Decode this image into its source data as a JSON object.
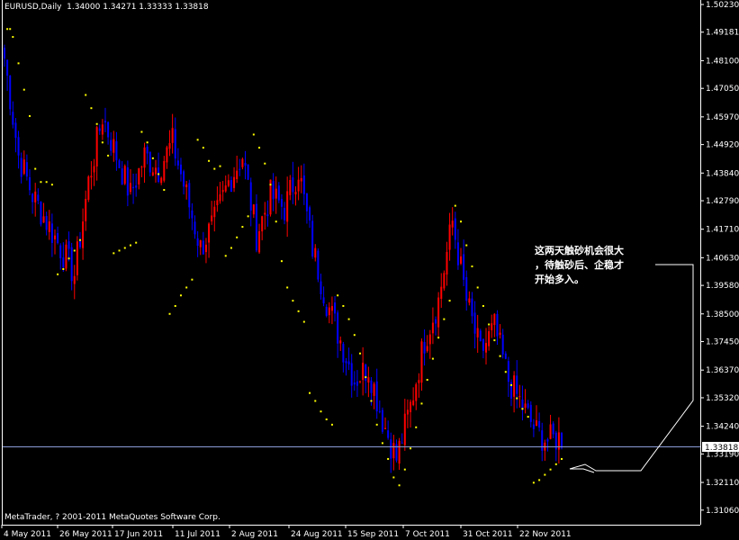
{
  "header": {
    "symbol": "EURUSD,Daily",
    "ohlc": "1.34000 1.34271 1.33333 1.33818"
  },
  "copyright": "MetaTrader, ? 2001-2011 MetaQuotes Software Corp.",
  "annotation": [
    "这两天触砂机会很大",
    "，待触砂后、企稳才",
    "开始多入。"
  ],
  "colors": {
    "background": "#000000",
    "bull_candle": "#ff0000",
    "bear_candle": "#0000ff",
    "parabolic_sar": "#ffff00",
    "axis": "#ffffff",
    "current_price_line": "#8c9bd6"
  },
  "chart_data": {
    "type": "candlestick",
    "title": "EURUSD,Daily",
    "indicator": "Parabolic SAR",
    "current_price": 1.33818,
    "ylim": [
      1.3061,
      1.5023
    ],
    "y_ticks": [
      "1.50230",
      "1.49181",
      "1.48100",
      "1.47050",
      "1.45970",
      "1.44920",
      "1.43840",
      "1.42790",
      "1.41710",
      "1.40630",
      "1.39580",
      "1.38500",
      "1.37450",
      "1.36370",
      "1.35320",
      "1.34240",
      "1.33190",
      "1.32110",
      "1.31060"
    ],
    "x_ticks": [
      "4 May 2011",
      "26 May 2011",
      "17 Jun 2011",
      "11 Jul 2011",
      "2 Aug 2011",
      "24 Aug 2011",
      "15 Sep 2011",
      "7 Oct 2011",
      "31 Oct 2011",
      "22 Nov 2011"
    ],
    "close_path": [
      [
        0,
        1.482
      ],
      [
        5,
        1.445
      ],
      [
        10,
        1.43
      ],
      [
        15,
        1.42
      ],
      [
        20,
        1.41
      ],
      [
        25,
        1.4
      ],
      [
        30,
        1.435
      ],
      [
        35,
        1.46
      ],
      [
        40,
        1.445
      ],
      [
        45,
        1.43
      ],
      [
        50,
        1.445
      ],
      [
        55,
        1.44
      ],
      [
        60,
        1.45
      ],
      [
        65,
        1.43
      ],
      [
        70,
        1.41
      ],
      [
        75,
        1.42
      ],
      [
        80,
        1.435
      ],
      [
        85,
        1.445
      ],
      [
        90,
        1.415
      ],
      [
        95,
        1.43
      ],
      [
        100,
        1.425
      ],
      [
        105,
        1.44
      ],
      [
        110,
        1.41
      ],
      [
        115,
        1.39
      ],
      [
        120,
        1.375
      ],
      [
        125,
        1.36
      ],
      [
        130,
        1.365
      ],
      [
        135,
        1.345
      ],
      [
        140,
        1.33
      ],
      [
        145,
        1.35
      ],
      [
        150,
        1.375
      ],
      [
        155,
        1.39
      ],
      [
        160,
        1.42
      ],
      [
        165,
        1.39
      ],
      [
        170,
        1.37
      ],
      [
        175,
        1.38
      ],
      [
        180,
        1.36
      ],
      [
        185,
        1.35
      ],
      [
        190,
        1.34
      ],
      [
        194,
        1.337
      ],
      [
        199,
        1.3382
      ]
    ],
    "sar_dots": [
      [
        1,
        1.493
      ],
      [
        2,
        1.493
      ],
      [
        3,
        1.49
      ],
      [
        5,
        1.48
      ],
      [
        7,
        1.47
      ],
      [
        9,
        1.46
      ],
      [
        11,
        1.44
      ],
      [
        13,
        1.435
      ],
      [
        15,
        1.435
      ],
      [
        17,
        1.434
      ],
      [
        19,
        1.4
      ],
      [
        21,
        1.402
      ],
      [
        23,
        1.406
      ],
      [
        25,
        1.409
      ],
      [
        27,
        1.413
      ],
      [
        29,
        1.468
      ],
      [
        31,
        1.463
      ],
      [
        33,
        1.457
      ],
      [
        35,
        1.45
      ],
      [
        37,
        1.445
      ],
      [
        39,
        1.408
      ],
      [
        41,
        1.409
      ],
      [
        43,
        1.41
      ],
      [
        45,
        1.411
      ],
      [
        47,
        1.412
      ],
      [
        49,
        1.454
      ],
      [
        51,
        1.45
      ],
      [
        53,
        1.444
      ],
      [
        55,
        1.438
      ],
      [
        57,
        1.432
      ],
      [
        59,
        1.385
      ],
      [
        61,
        1.388
      ],
      [
        63,
        1.392
      ],
      [
        65,
        1.395
      ],
      [
        67,
        1.398
      ],
      [
        69,
        1.451
      ],
      [
        71,
        1.448
      ],
      [
        73,
        1.443
      ],
      [
        75,
        1.44
      ],
      [
        77,
        1.441
      ],
      [
        79,
        1.407
      ],
      [
        81,
        1.41
      ],
      [
        83,
        1.414
      ],
      [
        85,
        1.418
      ],
      [
        87,
        1.422
      ],
      [
        89,
        1.453
      ],
      [
        91,
        1.448
      ],
      [
        93,
        1.442
      ],
      [
        95,
        1.434
      ],
      [
        97,
        1.42
      ],
      [
        99,
        1.405
      ],
      [
        101,
        1.395
      ],
      [
        103,
        1.39
      ],
      [
        105,
        1.386
      ],
      [
        107,
        1.382
      ],
      [
        109,
        1.355
      ],
      [
        111,
        1.352
      ],
      [
        113,
        1.348
      ],
      [
        115,
        1.345
      ],
      [
        117,
        1.343
      ],
      [
        119,
        1.392
      ],
      [
        121,
        1.388
      ],
      [
        123,
        1.383
      ],
      [
        125,
        1.377
      ],
      [
        127,
        1.37
      ],
      [
        129,
        1.361
      ],
      [
        131,
        1.352
      ],
      [
        133,
        1.343
      ],
      [
        135,
        1.336
      ],
      [
        137,
        1.33
      ],
      [
        139,
        1.323
      ],
      [
        141,
        1.32
      ],
      [
        143,
        1.326
      ],
      [
        145,
        1.334
      ],
      [
        147,
        1.342
      ],
      [
        149,
        1.351
      ],
      [
        151,
        1.36
      ],
      [
        153,
        1.368
      ],
      [
        155,
        1.376
      ],
      [
        157,
        1.383
      ],
      [
        159,
        1.39
      ],
      [
        161,
        1.426
      ],
      [
        163,
        1.42
      ],
      [
        165,
        1.411
      ],
      [
        167,
        1.403
      ],
      [
        169,
        1.395
      ],
      [
        171,
        1.388
      ],
      [
        173,
        1.381
      ],
      [
        175,
        1.375
      ],
      [
        177,
        1.369
      ],
      [
        179,
        1.363
      ],
      [
        181,
        1.358
      ],
      [
        183,
        1.353
      ],
      [
        185,
        1.349
      ],
      [
        187,
        1.346
      ],
      [
        189,
        1.321
      ],
      [
        191,
        1.322
      ],
      [
        193,
        1.324
      ],
      [
        195,
        1.326
      ],
      [
        197,
        1.328
      ],
      [
        199,
        1.33
      ]
    ]
  }
}
